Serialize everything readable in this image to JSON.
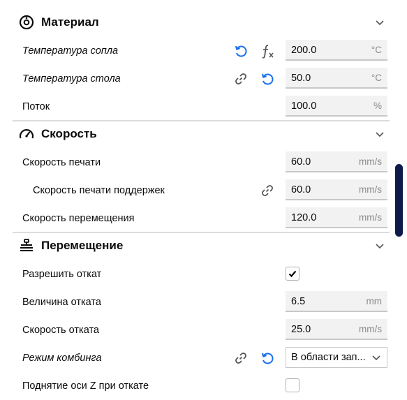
{
  "sections": {
    "material": {
      "title": "Материал",
      "rows": {
        "nozzle_temp": {
          "label": "Температура сопла",
          "value": "200.0",
          "unit": "°C"
        },
        "bed_temp": {
          "label": "Температура стола",
          "value": "50.0",
          "unit": "°C"
        },
        "flow": {
          "label": "Поток",
          "value": "100.0",
          "unit": "%"
        }
      }
    },
    "speed": {
      "title": "Скорость",
      "rows": {
        "print_speed": {
          "label": "Скорость печати",
          "value": "60.0",
          "unit": "mm/s"
        },
        "support_speed": {
          "label": "Скорость печати поддержек",
          "value": "60.0",
          "unit": "mm/s"
        },
        "travel_speed": {
          "label": "Скорость перемещения",
          "value": "120.0",
          "unit": "mm/s"
        }
      }
    },
    "travel": {
      "title": "Перемещение",
      "rows": {
        "retraction_enable": {
          "label": "Разрешить откат",
          "checked": true
        },
        "retraction_amount": {
          "label": "Величина отката",
          "value": "6.5",
          "unit": "mm"
        },
        "retraction_speed": {
          "label": "Скорость отката",
          "value": "25.0",
          "unit": "mm/s"
        },
        "combing_mode": {
          "label": "Режим комбинга",
          "value": "В области зап..."
        },
        "z_hop": {
          "label": "Поднятие оси Z при откате",
          "checked": false
        }
      }
    }
  },
  "colors": {
    "accent": "#196ef0",
    "icon": "#555555",
    "scrollbar": "#0e1a4a"
  },
  "icons": [
    "material-icon",
    "speed-icon",
    "travel-icon",
    "reset-icon",
    "function-icon",
    "link-icon",
    "chevron-down-icon"
  ]
}
